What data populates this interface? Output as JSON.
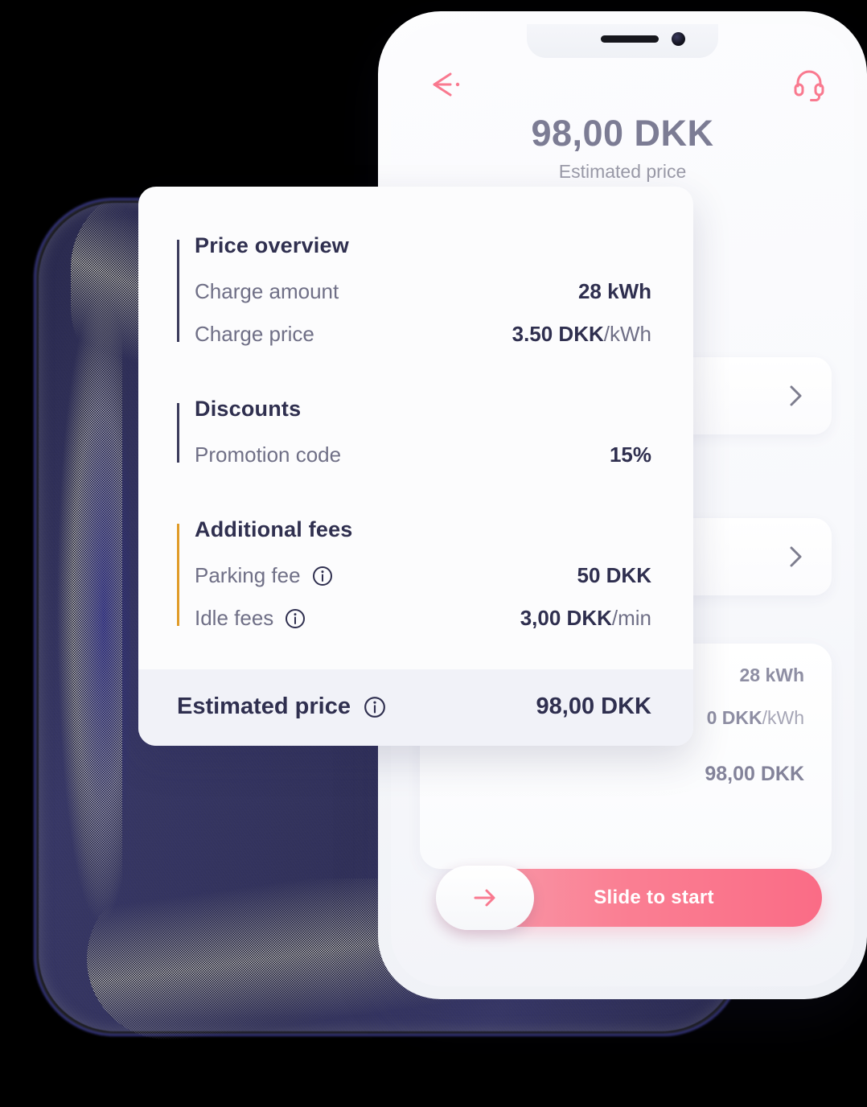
{
  "phone": {
    "header": {
      "back_icon": "arrow-left-icon",
      "support_icon": "headset-icon"
    },
    "hero": {
      "amount": "98,00 DKK",
      "label": "Estimated price"
    },
    "background_rows": [
      {
        "chevron_icon": "chevron-right-icon"
      },
      {
        "chevron_icon": "chevron-right-icon"
      }
    ],
    "background_summary": {
      "charge_amount": "28 kWh",
      "charge_price_value": "0 DKK",
      "charge_price_unit": "/kWh",
      "total": "98,00 DKK"
    },
    "slider": {
      "label": "Slide to start",
      "arrow_icon": "arrow-right-icon"
    }
  },
  "card": {
    "sections": [
      {
        "title": "Price overview",
        "accent": "#3b3b5c",
        "rows": [
          {
            "label": "Charge amount",
            "value": "28 kWh",
            "unit": "",
            "info": false
          },
          {
            "label": "Charge price",
            "value": "3.50 DKK",
            "unit": "/kWh",
            "info": false
          }
        ]
      },
      {
        "title": "Discounts",
        "accent": "#3b3b5c",
        "rows": [
          {
            "label": "Promotion code",
            "value": "15%",
            "unit": "",
            "info": false
          }
        ]
      },
      {
        "title": "Additional fees",
        "accent": "#e09b28",
        "rows": [
          {
            "label": "Parking fee",
            "value": "50 DKK",
            "unit": "",
            "info": true
          },
          {
            "label": "Idle fees",
            "value": "3,00 DKK",
            "unit": "/min",
            "info": true
          }
        ]
      }
    ],
    "footer": {
      "label": "Estimated price",
      "info_icon": "info-icon",
      "value": "98,00 DKK"
    }
  },
  "colors": {
    "accent_pink": "#fa6c86",
    "navy": "#2f2f4f",
    "amber": "#e09b28",
    "muted": "#6f6f86"
  }
}
